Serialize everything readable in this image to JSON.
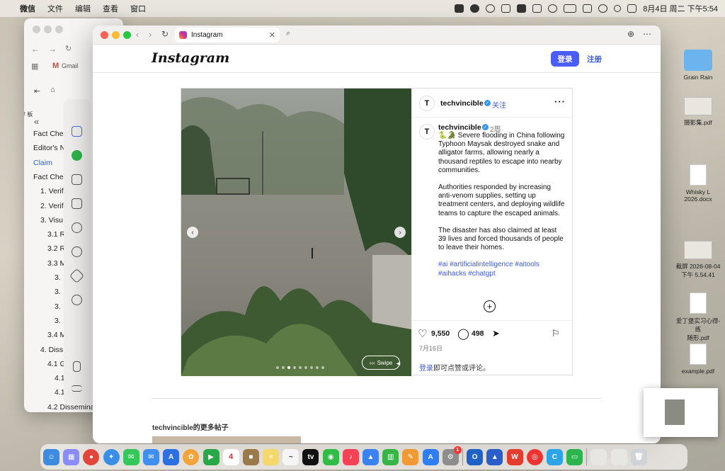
{
  "menubar": {
    "apple": "",
    "items": [
      "微信",
      "文件",
      "编辑",
      "查看",
      "窗口"
    ],
    "datetime": "8月4日 周二 下午5:54"
  },
  "bg_window": {
    "gmail_label": "Gmail",
    "sidebar_items": [
      {
        "label": "Fact Che",
        "active": false
      },
      {
        "label": "Editor's N",
        "active": false
      },
      {
        "label": "Claim",
        "active": true
      },
      {
        "label": "Fact Che",
        "active": false
      },
      {
        "label": "1. Verif",
        "active": false
      },
      {
        "label": "2. Verif",
        "active": false
      },
      {
        "label": "3. Visu",
        "active": false
      },
      {
        "label": "3.1 R",
        "active": false
      },
      {
        "label": "3.2 R",
        "active": false
      },
      {
        "label": "3.3 M",
        "active": false
      },
      {
        "label": "3.",
        "active": false
      },
      {
        "label": "3.",
        "active": false
      },
      {
        "label": "3.",
        "active": false
      },
      {
        "label": "3.",
        "active": false
      },
      {
        "label": "3.4 M",
        "active": false
      },
      {
        "label": "4. Diss",
        "active": false
      },
      {
        "label": "4.1 G",
        "active": false
      },
      {
        "label": "4.1",
        "active": false
      },
      {
        "label": "4.1",
        "active": false
      },
      {
        "label": "4.2 Disseminat",
        "active": false
      }
    ],
    "left_snippet": "推荐\n板"
  },
  "browser": {
    "tab_title": "Instagram"
  },
  "instagram": {
    "logo": "Instagram",
    "login_label": "登录",
    "signup_label": "注册",
    "username": "techvincible",
    "follow_label": "关注",
    "time_ago": "2周",
    "caption_lead": "🐍🐊 Severe flooding in China following Typhoon Maysak destroyed snake and alligator farms, allowing nearly a thousand reptiles to escape into nearby communities.",
    "caption_p2": "Authorities responded by increasing anti-venom supplies, setting up treatment centers, and deploying wildlife teams to capture the escaped animals.",
    "caption_p3": "The disaster has also claimed at least 39 lives and forced thousands of people to leave their homes.",
    "hashtags": "#ai #artificialintelligence #aitools #aihacks #chatgpt",
    "likes": "9,550",
    "comments": "498",
    "date": "7月16日",
    "login_prompt_link": "登录",
    "login_prompt_rest": "即可点赞或评论。",
    "swipe_label": "Swipe",
    "more_posts": "techvincible的更多帖子",
    "carousel_total": 9,
    "carousel_index": 3
  },
  "desktop_icons": [
    {
      "label": "Grain Rain",
      "kind": "folder"
    },
    {
      "label": "摄影集.pdf",
      "kind": "thumb"
    },
    {
      "label": "Whisky L\n2026.docx",
      "kind": "doc"
    },
    {
      "label": "截屏 2026-08-04\n下午 5.54.41",
      "kind": "thumb"
    },
    {
      "label": "爱丁堡实习心得-练\n随形.pdf",
      "kind": "doc"
    },
    {
      "label": "example.pdf",
      "kind": "doc"
    }
  ],
  "dock": {
    "calendar_day": "4",
    "badge": "1"
  }
}
